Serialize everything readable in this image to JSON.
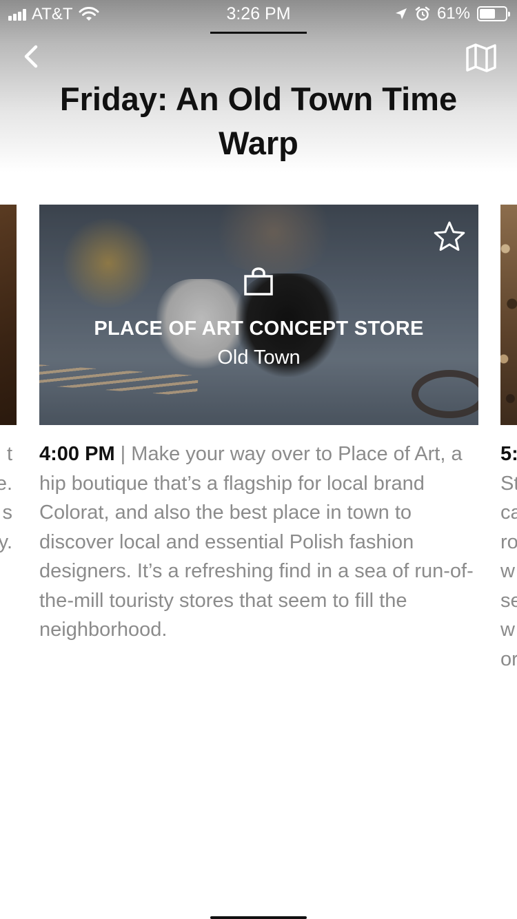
{
  "status_bar": {
    "carrier": "AT&T",
    "time": "3:26 PM",
    "battery_percent": "61%",
    "battery_level": 0.61,
    "icons": [
      "signal-icon",
      "wifi-icon",
      "location-arrow-icon",
      "alarm-icon",
      "battery-icon"
    ]
  },
  "nav": {
    "back_icon": "chevron-left-icon",
    "map_icon": "map-icon"
  },
  "page": {
    "title": "Friday: An Old Town Time Warp"
  },
  "card": {
    "category_icon": "shopping-bag-icon",
    "favorite_icon": "star-outline-icon",
    "title": "PLACE OF ART CONCEPT STORE",
    "subtitle": "Old Town"
  },
  "entry": {
    "time": "4:00 PM",
    "separator": "|",
    "description": "Make your way over to Place of Art, a hip boutique that’s a flagship for local brand Colorat, and also the best place in town to discover local and essential Polish fashion designers. It’s a refreshing find in a sea of run-of-the-mill touristy stores that seem to fill the neighborhood."
  },
  "peek_left_lines": [
    "t",
    "e.",
    "s",
    "y."
  ],
  "peek_right": {
    "time_fragment": "5:",
    "lines": [
      "St",
      "ca",
      "ro",
      "w",
      "se",
      "w",
      "or"
    ]
  },
  "colors": {
    "title": "#111111",
    "body_text": "#8b8b8b",
    "header_gradient_top": "#8e8e8e"
  }
}
